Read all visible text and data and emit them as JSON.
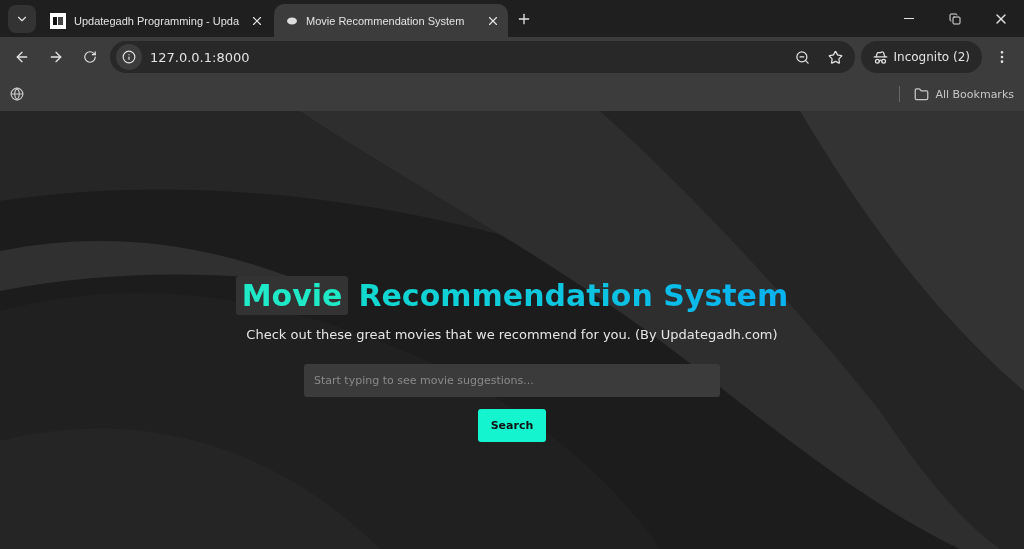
{
  "tabs": [
    {
      "title": "Updategadh Programming - Upda",
      "selected": false
    },
    {
      "title": "Movie Recommendation System",
      "selected": true
    }
  ],
  "address_bar": {
    "url": "127.0.0.1:8000"
  },
  "profile": {
    "label": "Incognito (2)"
  },
  "bookmarks_bar": {
    "label": "All Bookmarks"
  },
  "page": {
    "title_highlight": "Movie",
    "title_rest": "Recommendation System",
    "subtitle": "Check out these great movies that we recommend for you. (By Updategadh.com)",
    "search": {
      "placeholder": "Start typing to see movie suggestions..."
    },
    "button": "Search"
  }
}
